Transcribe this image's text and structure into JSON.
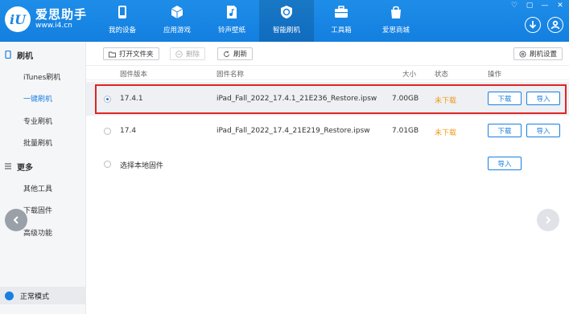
{
  "app": {
    "title": "爱思助手",
    "url": "www.i4.cn"
  },
  "nav": [
    {
      "label": "我的设备",
      "icon": "phone-icon"
    },
    {
      "label": "应用游戏",
      "icon": "cube-icon"
    },
    {
      "label": "铃声壁纸",
      "icon": "music-file-icon"
    },
    {
      "label": "智能刷机",
      "icon": "refresh-shield-icon",
      "active": true
    },
    {
      "label": "工具箱",
      "icon": "toolbox-icon"
    },
    {
      "label": "爱思商城",
      "icon": "shopping-bag-icon"
    }
  ],
  "window_controls": [
    "♡",
    "▢",
    "—",
    "✕"
  ],
  "sidebar": {
    "section1": "刷机",
    "items1": [
      "iTunes刷机",
      "一键刷机",
      "专业刷机",
      "批量刷机"
    ],
    "active_item": "一键刷机",
    "section2": "更多",
    "items2": [
      "其他工具",
      "下载固件",
      "高级功能"
    ],
    "mode": "正常模式"
  },
  "toolbar": {
    "open_folder": "打开文件夹",
    "delete": "删除",
    "refresh": "刷新",
    "settings": "刷机设置"
  },
  "table": {
    "headers": {
      "version": "固件版本",
      "name": "固件名称",
      "size": "大小",
      "status": "状态",
      "actions": "操作"
    },
    "rows": [
      {
        "version": "17.4.1",
        "name": "iPad_Fall_2022_17.4.1_21E236_Restore.ipsw",
        "size": "7.00GB",
        "status": "未下载",
        "download": "下载",
        "import": "导入",
        "selected": true
      },
      {
        "version": "17.4",
        "name": "iPad_Fall_2022_17.4_21E219_Restore.ipsw",
        "size": "7.01GB",
        "status": "未下载",
        "download": "下载",
        "import": "导入",
        "selected": false
      }
    ],
    "local": {
      "label": "选择本地固件",
      "import": "导入"
    }
  },
  "colors": {
    "header_blue": "#1a86e6",
    "accent": "#1a7fe0",
    "status_orange": "#f09a1a",
    "highlight_red": "#e02424"
  }
}
